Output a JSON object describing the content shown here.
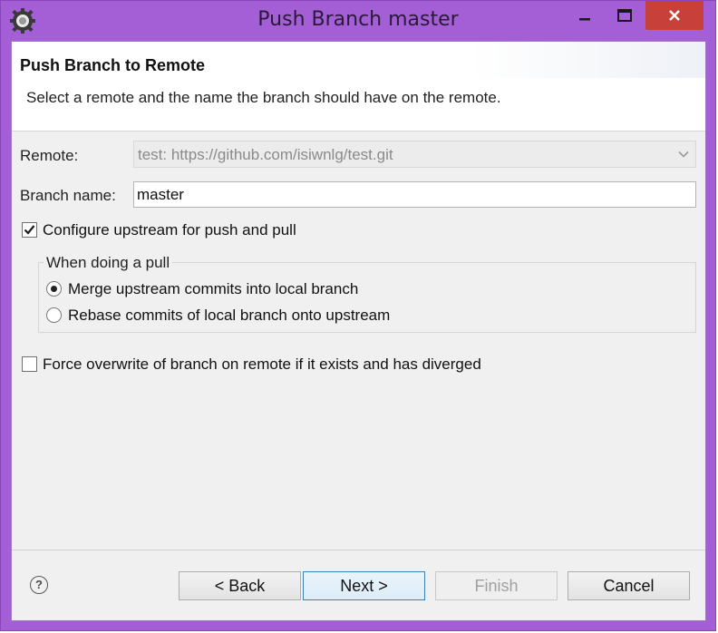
{
  "window": {
    "title": "Push Branch master"
  },
  "header": {
    "title": "Push Branch to Remote",
    "description": "Select a remote and the name the branch should have on the remote."
  },
  "form": {
    "remote_label": "Remote:",
    "remote_value": "test: https://github.com/isiwnlg/test.git",
    "branch_label": "Branch name:",
    "branch_value": "master",
    "configure_upstream": {
      "label": "Configure upstream for push and pull",
      "checked": true
    },
    "pull_group": {
      "title": "When doing a pull",
      "options": [
        {
          "label": "Merge upstream commits into local branch",
          "selected": true
        },
        {
          "label": "Rebase commits of local branch onto upstream",
          "selected": false
        }
      ]
    },
    "force_overwrite": {
      "label": "Force overwrite of branch on remote if it exists and has diverged",
      "checked": false
    }
  },
  "buttons": {
    "help": "?",
    "back": "< Back",
    "next": "Next >",
    "finish": "Finish",
    "cancel": "Cancel"
  },
  "icons": {
    "app": "eclipse-gear-icon",
    "minimize": "minimize-icon",
    "maximize": "maximize-icon",
    "close": "close-icon",
    "dropdown": "chevron-down-icon"
  },
  "colors": {
    "window_frame": "#a45fd6",
    "close_button": "#c7413a",
    "default_button_border": "#3c7fb1"
  }
}
